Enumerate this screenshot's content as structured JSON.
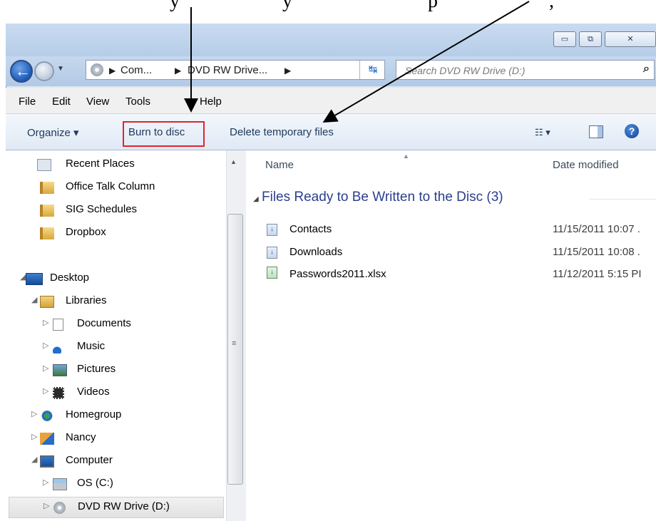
{
  "caption": {
    "left_fragment": "y",
    "middle_fragment": "y",
    "right_fragment": "p",
    "end_fragment": ","
  },
  "window": {
    "controls": {
      "minimize": "▭",
      "maximize": "⧉",
      "close": "✕"
    }
  },
  "address": {
    "crumbs": [
      "Com...",
      "DVD RW Drive...",
      ""
    ],
    "search_placeholder": "Search DVD RW Drive (D:)"
  },
  "menu": [
    "File",
    "Edit",
    "View",
    "Tools",
    "Help"
  ],
  "commands": {
    "organize": "Organize ▾",
    "burn": "Burn to disc",
    "delete": "Delete temporary files"
  },
  "nav": {
    "items": [
      {
        "label": "Recent Places",
        "icon": "recent-places-icon"
      },
      {
        "label": "Office Talk Column",
        "icon": "folder-icon"
      },
      {
        "label": "SIG Schedules",
        "icon": "folder-icon"
      },
      {
        "label": "Dropbox",
        "icon": "folder-icon"
      },
      {
        "label": "Desktop",
        "icon": "desktop-icon"
      },
      {
        "label": "Libraries",
        "icon": "libraries-icon"
      },
      {
        "label": "Documents",
        "icon": "documents-icon"
      },
      {
        "label": "Music",
        "icon": "music-icon"
      },
      {
        "label": "Pictures",
        "icon": "pictures-icon"
      },
      {
        "label": "Videos",
        "icon": "videos-icon"
      },
      {
        "label": "Homegroup",
        "icon": "homegroup-icon"
      },
      {
        "label": "Nancy",
        "icon": "user-icon"
      },
      {
        "label": "Computer",
        "icon": "computer-icon"
      },
      {
        "label": "OS (C:)",
        "icon": "drive-icon"
      },
      {
        "label": "DVD RW Drive (D:)",
        "icon": "dvd-drive-icon"
      }
    ]
  },
  "content": {
    "columns": [
      "Name",
      "Date modified"
    ],
    "group_title": "Files Ready to Be Written to the Disc (3)",
    "files": [
      {
        "name": "Contacts",
        "date": "11/15/2011 10:07 ."
      },
      {
        "name": "Downloads",
        "date": "11/15/2011 10:08 ."
      },
      {
        "name": "Passwords2011.xlsx",
        "date": "11/12/2011 5:15 PI"
      }
    ]
  },
  "colors": {
    "accent_red": "#e0252b",
    "group_blue": "#2b3e8c",
    "command_text": "#1e395b"
  }
}
